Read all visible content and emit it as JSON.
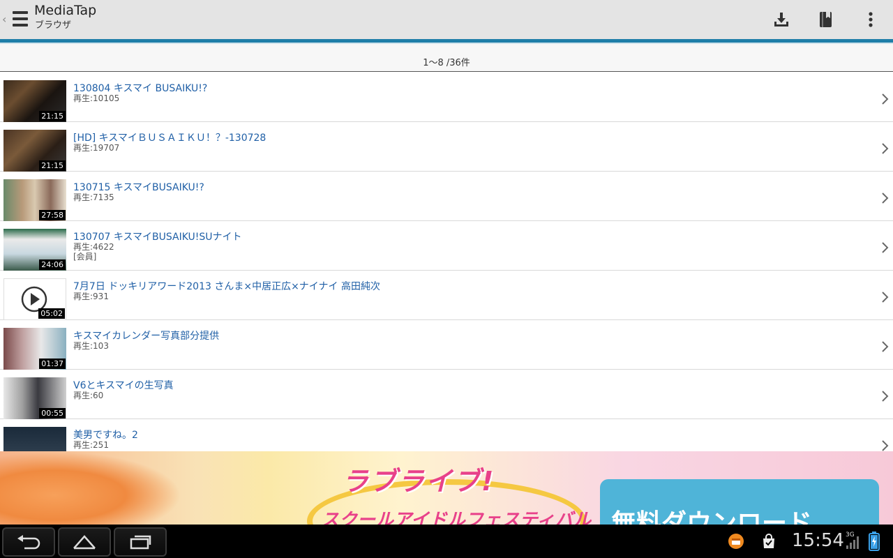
{
  "app": {
    "title": "MediaTap",
    "subtitle": "ブラウザ"
  },
  "header_icons": [
    "download-icon",
    "bookmark-icon",
    "overflow-menu-icon"
  ],
  "count_text": "1～8 /36件",
  "videos": [
    {
      "title": "130804 キスマイ BUSAIKU!?",
      "plays": "再生:10105",
      "duration": "21:15",
      "badge": ""
    },
    {
      "title": "[HD] キスマイＢＵＳＡＩＫＵ！？-130728",
      "plays": "再生:19707",
      "duration": "21:15",
      "badge": ""
    },
    {
      "title": "130715 キスマイBUSAIKU!?",
      "plays": "再生:7135",
      "duration": "27:58",
      "badge": ""
    },
    {
      "title": "130707 キスマイBUSAIKU!SUナイト",
      "plays": "再生:4622",
      "duration": "24:06",
      "badge": "[会員]"
    },
    {
      "title": "7月7日 ドッキリアワード2013 さんま×中居正広×ナイナイ 高田純次",
      "plays": "再生:931",
      "duration": "05:02",
      "badge": ""
    },
    {
      "title": "キスマイカレンダー写真部分提供",
      "plays": "再生:103",
      "duration": "01:37",
      "badge": ""
    },
    {
      "title": "V6とキスマイの生写真",
      "plays": "再生:60",
      "duration": "00:55",
      "badge": ""
    },
    {
      "title": "美男ですね。2",
      "plays": "再生:251",
      "duration": "",
      "badge": ""
    }
  ],
  "ad": {
    "title": "ラブライブ!",
    "subtitle": "スクールアイドルフェスティバル",
    "button": "無料ダウンロード"
  },
  "system": {
    "clock": "15:54",
    "network": "3G"
  }
}
